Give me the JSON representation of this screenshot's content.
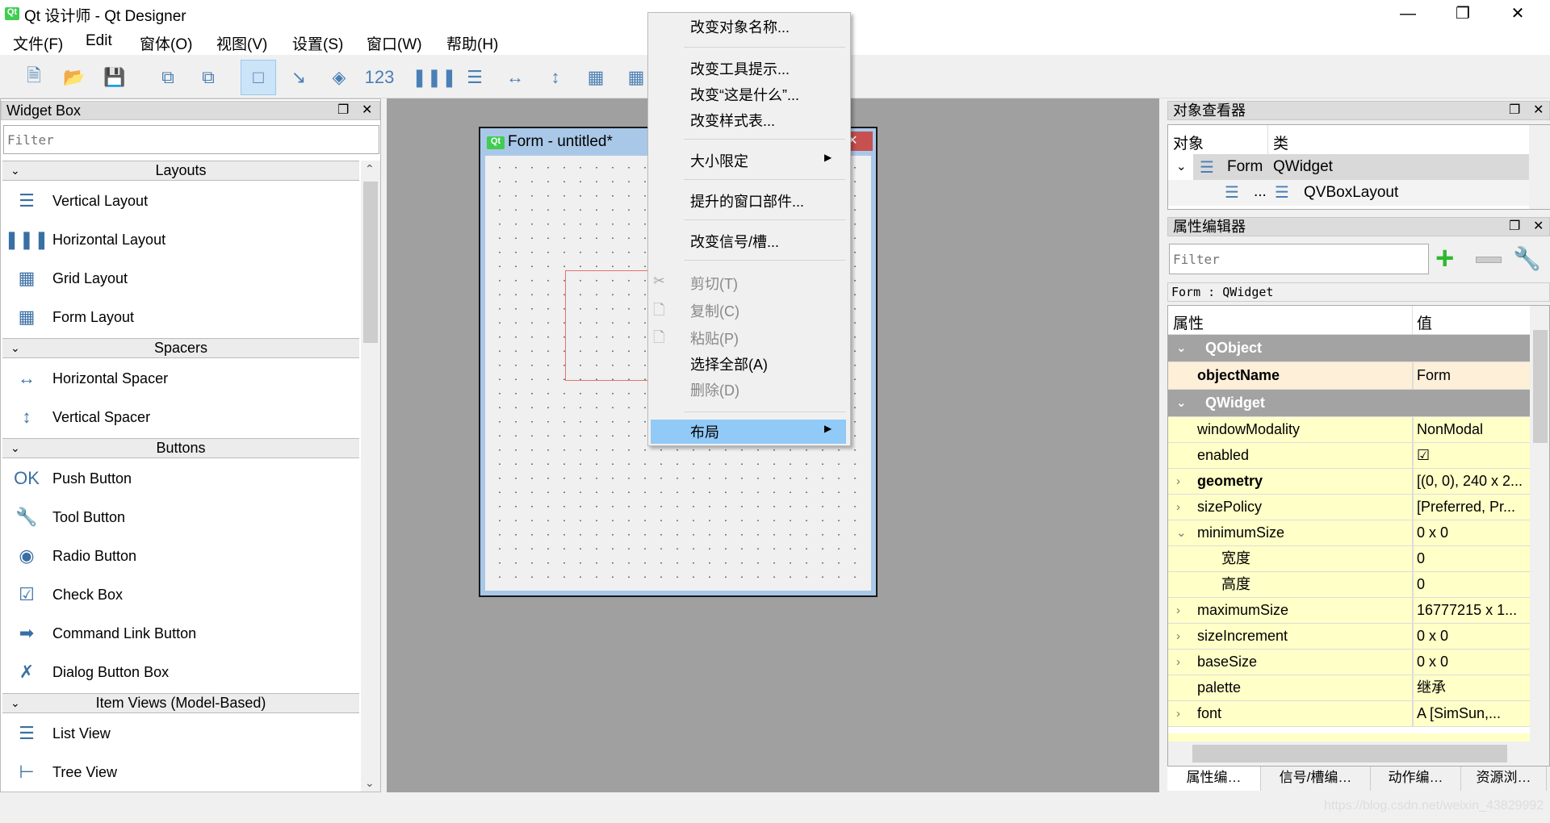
{
  "window": {
    "title": "Qt 设计师 - Qt Designer",
    "logo": "Qt",
    "minimize_icon": "minimize-icon",
    "maximize_icon": "restore-icon",
    "close_icon": "close-icon"
  },
  "menubar": [
    "文件(F)",
    "Edit",
    "窗体(O)",
    "视图(V)",
    "设置(S)",
    "窗口(W)",
    "帮助(H)"
  ],
  "toolbar": [
    "new-file-icon",
    "open-folder-icon",
    "save-icon",
    "copy-icon",
    "paste-icon",
    "edit-widgets-icon",
    "edit-signals-slots-icon",
    "edit-buddies-icon",
    "edit-tab-order-icon",
    "layout-horizontal-icon",
    "layout-vertical-icon",
    "layout-h-splitter-icon",
    "layout-v-splitter-icon",
    "layout-grid-icon",
    "layout-form-icon"
  ],
  "widget_box": {
    "title": "Widget Box",
    "filter_placeholder": "Filter",
    "sections": [
      {
        "label": "Layouts",
        "items": [
          "Vertical Layout",
          "Horizontal Layout",
          "Grid Layout",
          "Form Layout"
        ]
      },
      {
        "label": "Spacers",
        "items": [
          "Horizontal Spacer",
          "Vertical Spacer"
        ]
      },
      {
        "label": "Buttons",
        "items": [
          "Push Button",
          "Tool Button",
          "Radio Button",
          "Check Box",
          "Command Link Button",
          "Dialog Button Box"
        ]
      },
      {
        "label": "Item Views (Model-Based)",
        "items": [
          "List View",
          "Tree View"
        ]
      }
    ]
  },
  "form_window": {
    "title": "Form - untitled*",
    "logo": "Qt"
  },
  "context_menu": {
    "items": [
      {
        "label": "改变对象名称...",
        "enabled": true
      },
      {
        "label": "改变工具提示...",
        "enabled": true
      },
      {
        "label": "改变“这是什么”...",
        "enabled": true
      },
      {
        "label": "改变样式表...",
        "enabled": true
      },
      {
        "label": "大小限定",
        "enabled": true,
        "submenu": true
      },
      {
        "label": "提升的窗口部件...",
        "enabled": true
      },
      {
        "label": "改变信号/槽...",
        "enabled": true
      },
      {
        "label": "剪切(T)",
        "enabled": false,
        "icon": "scissors-icon"
      },
      {
        "label": "复制(C)",
        "enabled": false,
        "icon": "copy-icon"
      },
      {
        "label": "粘贴(P)",
        "enabled": false,
        "icon": "paste-icon"
      },
      {
        "label": "选择全部(A)",
        "enabled": true
      },
      {
        "label": "删除(D)",
        "enabled": false
      },
      {
        "label": "布局",
        "enabled": true,
        "submenu": true,
        "highlighted": true
      }
    ]
  },
  "object_inspector": {
    "title": "对象查看器",
    "col_object": "对象",
    "col_class": "类",
    "rows": [
      {
        "object": "Form",
        "class": "QWidget"
      },
      {
        "object": "...",
        "class": "QVBoxLayout"
      }
    ]
  },
  "property_editor": {
    "title": "属性编辑器",
    "filter_placeholder": "Filter",
    "context": "Form : QWidget",
    "col_property": "属性",
    "col_value": "值",
    "rows": [
      {
        "name": "QObject",
        "group": true
      },
      {
        "name": "objectName",
        "value": "Form",
        "bold": true
      },
      {
        "name": "QWidget",
        "group": true
      },
      {
        "name": "windowModality",
        "value": "NonModal"
      },
      {
        "name": "enabled",
        "value": "☑"
      },
      {
        "name": "geometry",
        "value": "[(0, 0), 240 x 2...",
        "bold": true,
        "expander": "›"
      },
      {
        "name": "sizePolicy",
        "value": "[Preferred, Pr...",
        "expander": "›"
      },
      {
        "name": "minimumSize",
        "value": "0 x 0",
        "expander": "⌄"
      },
      {
        "name": "宽度",
        "value": "0",
        "sub": true
      },
      {
        "name": "高度",
        "value": "0",
        "sub": true
      },
      {
        "name": "maximumSize",
        "value": "16777215 x 1...",
        "expander": "›"
      },
      {
        "name": "sizeIncrement",
        "value": "0 x 0",
        "expander": "›"
      },
      {
        "name": "baseSize",
        "value": "0 x 0",
        "expander": "›"
      },
      {
        "name": "palette",
        "value": "继承"
      },
      {
        "name": "font",
        "value": "A   [SimSun,...",
        "expander": "›"
      }
    ]
  },
  "bottom_tabs": [
    "属性编…",
    "信号/槽编…",
    "动作编…",
    "资源浏…"
  ],
  "watermark": "https://blog.csdn.net/weixin_43829992",
  "colors": {
    "menu_highlight": "#91c9f7",
    "group_row": "#a3a3a3",
    "property_row": "#ffffc8",
    "object_row": "#fdefd8"
  }
}
